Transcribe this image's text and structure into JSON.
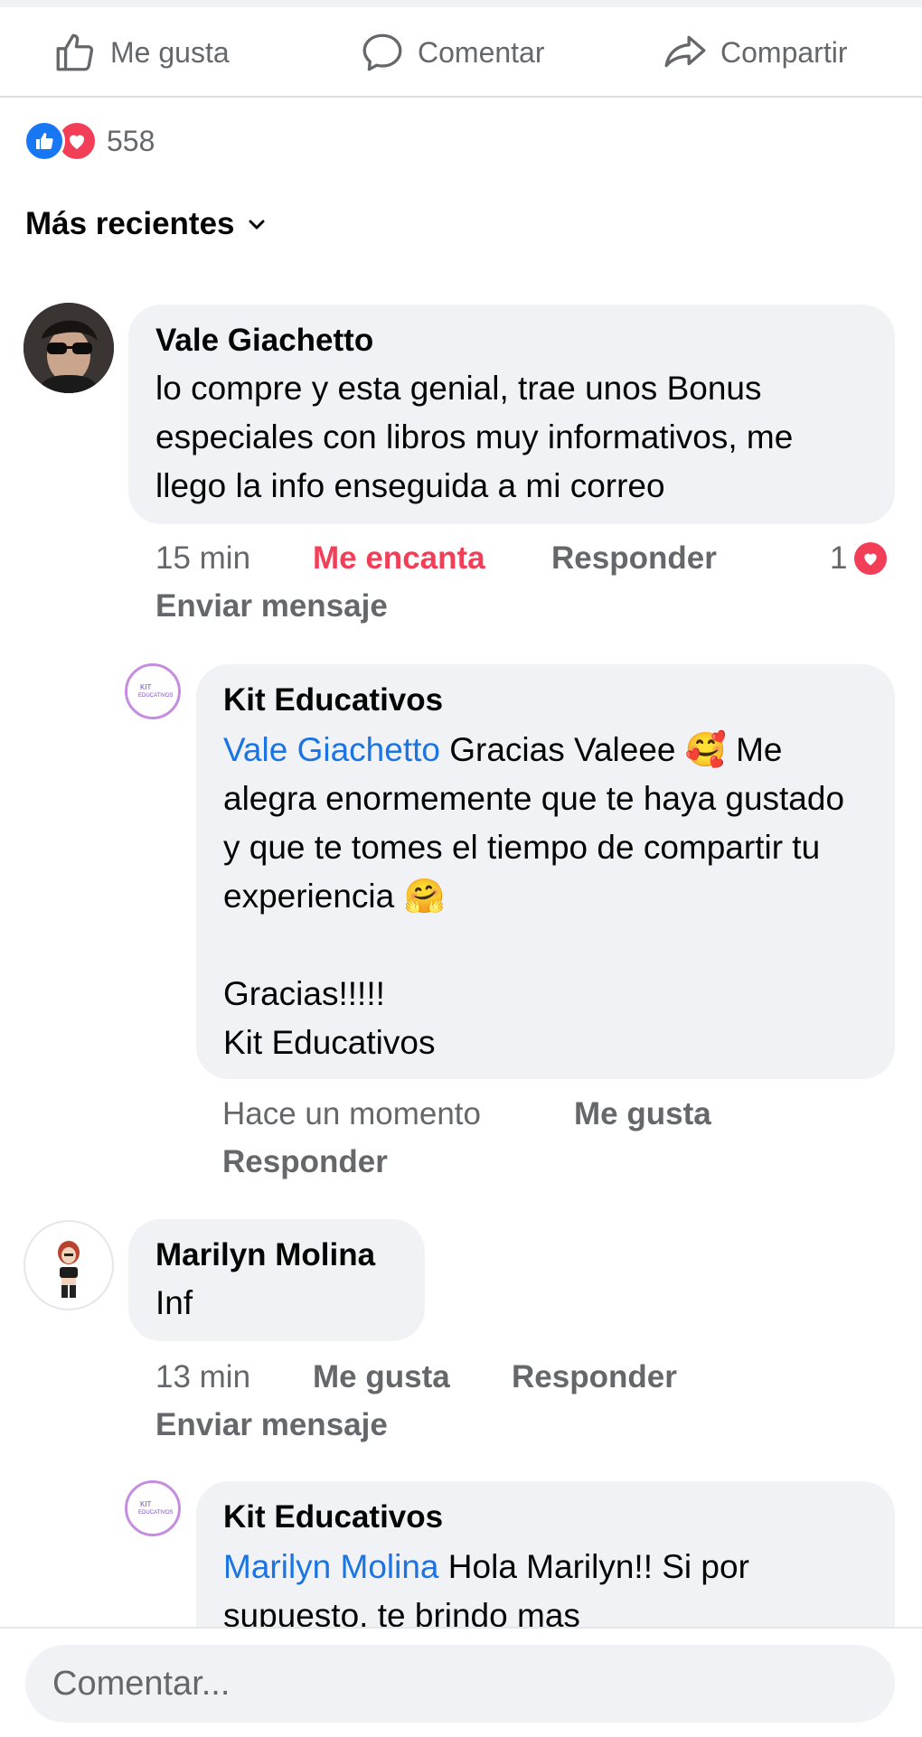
{
  "actions": {
    "like": "Me gusta",
    "comment": "Comentar",
    "share": "Compartir"
  },
  "reactions": {
    "count": "558",
    "icons": [
      "like-icon",
      "love-icon"
    ]
  },
  "sort": {
    "label": "Más recientes"
  },
  "comments": [
    {
      "name": "Vale Giachetto",
      "text": "lo compre y esta genial, trae unos Bonus especiales con libros muy informativos, me llego la info enseguida a mi correo",
      "time": "15 min",
      "reaction_label": "Me encanta",
      "reply": "Responder",
      "react_count": "1",
      "send_message": "Enviar mensaje"
    },
    {
      "name": "Kit Educativos",
      "mention": "Vale Giachetto",
      "text_line1": " Gracias Valeee 🥰 Me alegra enormemente que te haya gustado y que te tomes el tiempo de compartir tu experiencia 🤗",
      "text_line2": "Gracias!!!!!",
      "text_line3": "Kit Educativos",
      "time": "Hace un momento",
      "like": "Me gusta",
      "reply": "Responder"
    },
    {
      "name": "Marilyn Molina",
      "text": "Inf",
      "time": "13 min",
      "like": "Me gusta",
      "reply": "Responder",
      "send_message": "Enviar mensaje"
    },
    {
      "name": "Kit Educativos",
      "mention": "Marilyn Molina",
      "text": " Hola Marilyn!! Si por supuesto, te brindo mas"
    }
  ],
  "composer": {
    "placeholder": "Comentar..."
  },
  "colors": {
    "accent": "#1877f2",
    "love": "#f33e58",
    "mention": "#1b74e4",
    "bubble": "#f0f2f5"
  }
}
